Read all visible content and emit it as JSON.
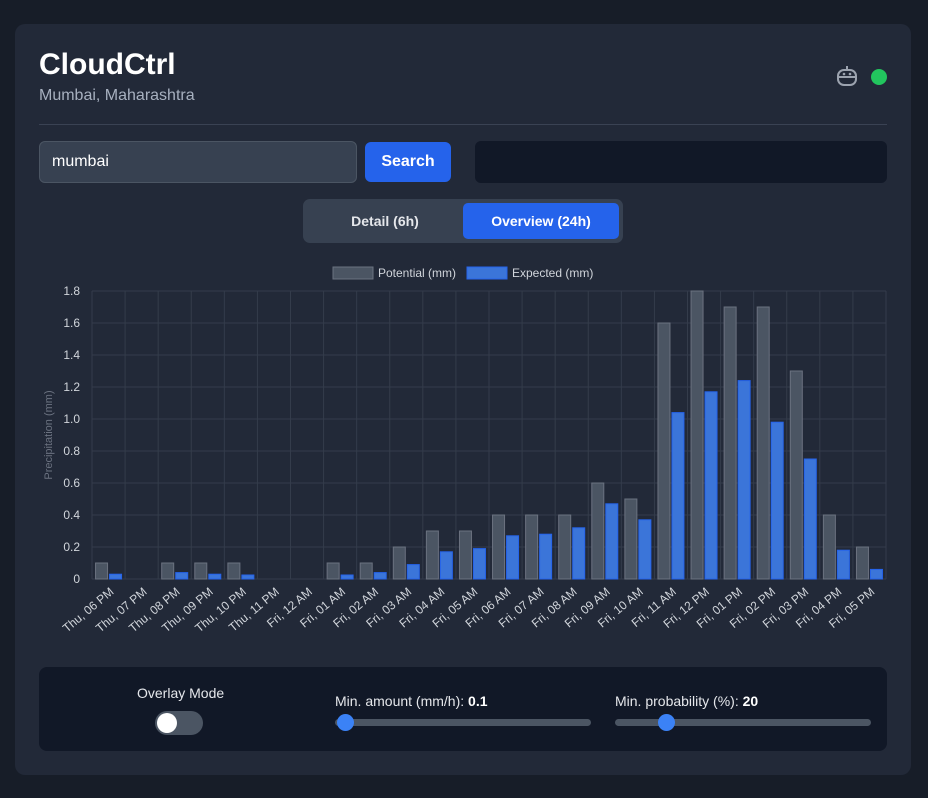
{
  "header": {
    "title": "CloudCtrl",
    "location": "Mumbai, Maharashtra",
    "status_color": "#22c55e"
  },
  "search": {
    "value": "mumbai",
    "button_label": "Search"
  },
  "tabs": [
    {
      "label": "Detail (6h)",
      "active": false
    },
    {
      "label": "Overview (24h)",
      "active": true
    }
  ],
  "chart_data": {
    "type": "bar",
    "categories": [
      "Thu, 06 PM",
      "Thu, 07 PM",
      "Thu, 08 PM",
      "Thu, 09 PM",
      "Thu, 10 PM",
      "Thu, 11 PM",
      "Fri, 12 AM",
      "Fri, 01 AM",
      "Fri, 02 AM",
      "Fri, 03 AM",
      "Fri, 04 AM",
      "Fri, 05 AM",
      "Fri, 06 AM",
      "Fri, 07 AM",
      "Fri, 08 AM",
      "Fri, 09 AM",
      "Fri, 10 AM",
      "Fri, 11 AM",
      "Fri, 12 PM",
      "Fri, 01 PM",
      "Fri, 02 PM",
      "Fri, 03 PM",
      "Fri, 04 PM",
      "Fri, 05 PM"
    ],
    "series": [
      {
        "name": "Potential (mm)",
        "color": "#4b5563",
        "values": [
          0.1,
          0,
          0.1,
          0.1,
          0.1,
          0,
          0,
          0.1,
          0.1,
          0.2,
          0.3,
          0.3,
          0.4,
          0.4,
          0.4,
          0.6,
          0.5,
          1.6,
          1.8,
          1.7,
          1.7,
          1.3,
          0.4,
          0.2
        ]
      },
      {
        "name": "Expected (mm)",
        "color": "#3b75d9",
        "values": [
          0.03,
          0,
          0.04,
          0.03,
          0.025,
          0,
          0,
          0.025,
          0.04,
          0.09,
          0.17,
          0.19,
          0.27,
          0.28,
          0.32,
          0.47,
          0.37,
          1.04,
          1.17,
          1.24,
          0.98,
          0.75,
          0.18,
          0.06
        ]
      }
    ],
    "ylabel": "Precipitation (mm)",
    "xlabel": "",
    "ylim": [
      0,
      1.8
    ],
    "yticks": [
      "0",
      "0.2",
      "0.4",
      "0.6",
      "0.8",
      "1.0",
      "1.2",
      "1.4",
      "1.6",
      "1.8"
    ],
    "legend": "top",
    "grid": true
  },
  "controls": {
    "overlay_label": "Overlay Mode",
    "overlay_on": false,
    "min_amount_label": "Min. amount (mm/h):",
    "min_amount_value": "0.1",
    "min_amount_fraction": 0.04,
    "min_probability_label": "Min. probability (%):",
    "min_probability_value": "20",
    "min_probability_fraction": 0.2
  }
}
